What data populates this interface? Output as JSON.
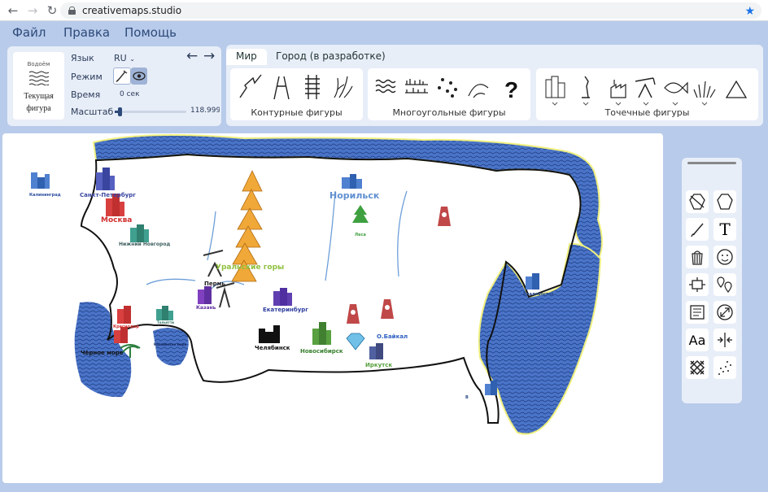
{
  "browser": {
    "url": "creativemaps.studio"
  },
  "menu": {
    "file": "Файл",
    "edit": "Правка",
    "help": "Помощь"
  },
  "figure": {
    "sample_label": "Водоём",
    "caption_line1": "Текущая",
    "caption_line2": "фигура"
  },
  "settings": {
    "language_label": "Язык",
    "language_value": "RU",
    "mode_label": "Режим",
    "time_label": "Время",
    "time_value": "0 сек",
    "scale_label": "Масштаб",
    "scale_value": "118.99999",
    "scale_fraction": 0.05
  },
  "tabs": [
    {
      "label": "Мир"
    },
    {
      "label": "Город (в разработке)"
    }
  ],
  "groups": {
    "contour": "Контурные фигуры",
    "polygon": "Многоугольные фигуры",
    "point": "Точечные фигуры"
  },
  "map": {
    "labels": {
      "kaliningrad": "Калининград",
      "spb": "Санкт-Петербург",
      "moscow": "Москва",
      "nnovgorod": "Нижний Новгород",
      "norilsk": "Норильск",
      "forest": "Леса",
      "mountains": "Уральские горы",
      "perm": "Пермь",
      "kazan": "Казань",
      "ekb": "Екатеринбург",
      "vladivostok": "Владивосток",
      "krasnodar": "Краснодар",
      "tolyatti": "Тольятти",
      "blacksea": "Чёрное море",
      "caspian": "Каспийское море",
      "chelyabinsk": "Челябинск",
      "novosibirsk": "Новосибирск",
      "baikal": "О.Байкал",
      "irkutsk": "Иркутск",
      "vl2": "В"
    }
  },
  "colors": {
    "water": "#4a74c8",
    "accent": "#2d4a7a",
    "mountain": "#f0a838"
  }
}
